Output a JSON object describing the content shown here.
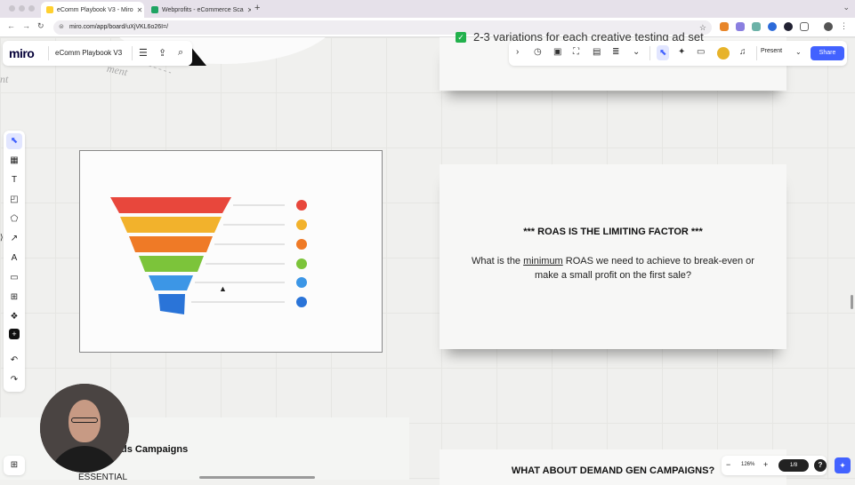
{
  "browser": {
    "tabs": [
      {
        "title": "eComm Playbook V3 - Miro",
        "favicon_color": "#ffd02f",
        "close": "✕"
      },
      {
        "title": "Webprofits - eCommerce Sca",
        "favicon_color": "#1fa463",
        "close": "✕"
      }
    ],
    "new_tab": "+",
    "url": "miro.com/app/board/uXjVKL6o26I=/"
  },
  "miro": {
    "logo": "miro",
    "board_name": "eComm Playbook V3",
    "present_label": "Present",
    "share_label": "Share"
  },
  "canvas_deco": {
    "text_left": "nt",
    "text_tilted": "ment"
  },
  "cards": {
    "card1_text": "2-3 variations for each creative testing ad set",
    "card2_title": "*** ROAS IS THE LIMITING FACTOR ***",
    "card2_body_pre": "What is the ",
    "card2_body_underlined": "minimum",
    "card2_body_post": " ROAS we need to achieve to break-even or",
    "card2_body_line2": "make a small profit on the first sale?",
    "card3_title": "WHAT ABOUT DEMAND GEN CAMPAIGNS?"
  },
  "bottom_left": {
    "title": "ds Campaigns",
    "subtitle": "ESSENTIAL"
  },
  "zoom": {
    "minus": "−",
    "level": "126%",
    "plus": "+",
    "page": "1/8",
    "help": "?"
  },
  "funnel": {
    "layer_colors": [
      "#e8473c",
      "#f2b22c",
      "#ef7a26",
      "#7cc43a",
      "#3c96e6",
      "#2a74d8"
    ],
    "dot_colors": [
      "#e8473c",
      "#f2b22c",
      "#ef7a26",
      "#7cc43a",
      "#3c96e6",
      "#2a74d8"
    ]
  },
  "colors": {
    "accent": "#4262ff",
    "check": "#22b14c"
  }
}
